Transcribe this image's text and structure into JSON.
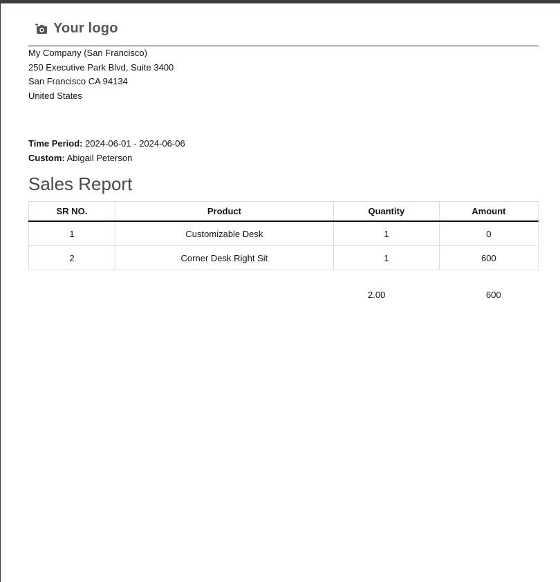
{
  "logo": {
    "text": "Your logo",
    "icon": "camera-plus-icon"
  },
  "company": {
    "name": "My Company (San Francisco)",
    "street": "250 Executive Park Blvd, Suite 3400",
    "city": "San Francisco CA 94134",
    "country": "United States"
  },
  "meta": {
    "period_label": "Time Period:",
    "period_value": "2024-06-01 - 2024-06-06",
    "custom_label": "Custom:",
    "custom_value": "Abigail Peterson"
  },
  "report": {
    "title": "Sales Report",
    "columns": [
      "SR NO.",
      "Product",
      "Quantity",
      "Amount"
    ],
    "rows": [
      [
        "1",
        "Customizable Desk",
        "1",
        "0"
      ],
      [
        "2",
        "Corner Desk Right Sit",
        "1",
        "600"
      ]
    ],
    "total_quantity": "2.00",
    "total_amount": "600"
  },
  "colors": {
    "topbar": "#3b3f44",
    "title": "#4a4a4a"
  }
}
